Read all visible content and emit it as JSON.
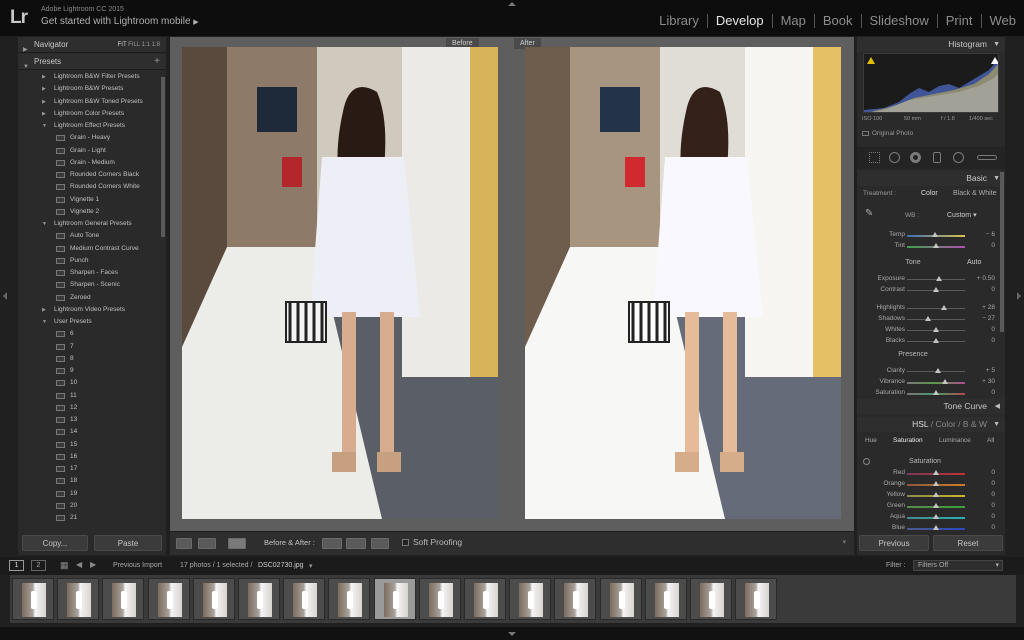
{
  "header": {
    "logo": "Lr",
    "app_version": "Adobe Lightroom CC 2015",
    "get_started": "Get started with Lightroom mobile",
    "get_started_arrow": "▶"
  },
  "modules": [
    "Library",
    "Develop",
    "Map",
    "Book",
    "Slideshow",
    "Print",
    "Web"
  ],
  "navigator": {
    "title": "Navigator",
    "zoom_options": [
      "FIT",
      "FILL",
      "1:1",
      "1:8"
    ]
  },
  "presets": {
    "title": "Presets",
    "add": "+",
    "items": [
      {
        "t": "f",
        "label": "Lightroom B&W Filter Presets",
        "open": false
      },
      {
        "t": "f",
        "label": "Lightroom B&W Presets",
        "open": false
      },
      {
        "t": "f",
        "label": "Lightroom B&W Toned Presets",
        "open": false
      },
      {
        "t": "f",
        "label": "Lightroom Color Presets",
        "open": false
      },
      {
        "t": "f",
        "label": "Lightroom Effect Presets",
        "open": true
      },
      {
        "t": "c",
        "label": "Grain - Heavy"
      },
      {
        "t": "c",
        "label": "Grain - Light"
      },
      {
        "t": "c",
        "label": "Grain - Medium"
      },
      {
        "t": "c",
        "label": "Rounded Corners Black"
      },
      {
        "t": "c",
        "label": "Rounded Corners White"
      },
      {
        "t": "c",
        "label": "Vignette 1"
      },
      {
        "t": "c",
        "label": "Vignette 2"
      },
      {
        "t": "f",
        "label": "Lightroom General Presets",
        "open": true
      },
      {
        "t": "c",
        "label": "Auto Tone"
      },
      {
        "t": "c",
        "label": "Medium Contrast Curve"
      },
      {
        "t": "c",
        "label": "Punch"
      },
      {
        "t": "c",
        "label": "Sharpen - Faces"
      },
      {
        "t": "c",
        "label": "Sharpen - Scenic"
      },
      {
        "t": "c",
        "label": "Zeroed"
      },
      {
        "t": "f",
        "label": "Lightroom Video Presets",
        "open": false
      },
      {
        "t": "f",
        "label": "User Presets",
        "open": true
      },
      {
        "t": "c",
        "label": "6"
      },
      {
        "t": "c",
        "label": "7"
      },
      {
        "t": "c",
        "label": "8"
      },
      {
        "t": "c",
        "label": "9"
      },
      {
        "t": "c",
        "label": "10"
      },
      {
        "t": "c",
        "label": "11"
      },
      {
        "t": "c",
        "label": "12"
      },
      {
        "t": "c",
        "label": "13"
      },
      {
        "t": "c",
        "label": "14"
      },
      {
        "t": "c",
        "label": "15"
      },
      {
        "t": "c",
        "label": "16"
      },
      {
        "t": "c",
        "label": "17"
      },
      {
        "t": "c",
        "label": "18"
      },
      {
        "t": "c",
        "label": "19"
      },
      {
        "t": "c",
        "label": "20"
      },
      {
        "t": "c",
        "label": "21"
      }
    ]
  },
  "left_buttons": {
    "copy": "Copy...",
    "paste": "Paste"
  },
  "view": {
    "before": "Before",
    "after": "After"
  },
  "toolbar": {
    "before_after": "Before & After :",
    "soft_proofing": "Soft Proofing"
  },
  "histogram": {
    "title": "Histogram",
    "iso": "ISO 100",
    "focal": "50 mm",
    "aperture": "f / 1.8",
    "shutter": "1/400 sec",
    "original": "Original Photo"
  },
  "basic": {
    "title": "Basic",
    "treatment_label": "Treatment :",
    "color": "Color",
    "bw": "Black & White",
    "wb_label": "WB :",
    "wb_value": "Custom",
    "tone_label": "Tone",
    "auto": "Auto",
    "presence_label": "Presence",
    "sliders": [
      {
        "k": "temp",
        "label": "Temp",
        "value": "− 6",
        "pos": 0.48,
        "grad": "linear-gradient(90deg,#3d6fb5,#d9c24a)"
      },
      {
        "k": "tint",
        "label": "Tint",
        "value": "0",
        "pos": 0.5,
        "grad": "linear-gradient(90deg,#3fa34a,#b24fb0)"
      },
      {
        "k": "exposure",
        "label": "Exposure",
        "value": "+ 0.50",
        "pos": 0.55
      },
      {
        "k": "contrast",
        "label": "Contrast",
        "value": "0",
        "pos": 0.5
      },
      {
        "k": "highlights",
        "label": "Highlights",
        "value": "+ 28",
        "pos": 0.64
      },
      {
        "k": "shadows",
        "label": "Shadows",
        "value": "− 27",
        "pos": 0.36
      },
      {
        "k": "whites",
        "label": "Whites",
        "value": "0",
        "pos": 0.5
      },
      {
        "k": "blacks",
        "label": "Blacks",
        "value": "0",
        "pos": 0.5
      },
      {
        "k": "clarity",
        "label": "Clarity",
        "value": "+ 5",
        "pos": 0.53
      },
      {
        "k": "vibrance",
        "label": "Vibrance",
        "value": "+ 30",
        "pos": 0.65,
        "grad": "linear-gradient(90deg,#777,#5b9a4b,#b04a8f)"
      },
      {
        "k": "saturation",
        "label": "Saturation",
        "value": "0",
        "pos": 0.5,
        "grad": "linear-gradient(90deg,#777,#4b9a6b,#b04a4a)"
      }
    ]
  },
  "tone_curve": {
    "title": "Tone Curve"
  },
  "hsl": {
    "title": "HSL",
    "color": "Color",
    "bw": "B & W",
    "sep": "/",
    "tabs": [
      "Hue",
      "Saturation",
      "Luminance",
      "All"
    ],
    "section": "Saturation",
    "sliders": [
      {
        "label": "Red",
        "value": "0",
        "grad": "linear-gradient(90deg,#7a3a5a,#c03030)"
      },
      {
        "label": "Orange",
        "value": "0",
        "grad": "linear-gradient(90deg,#8a5a3a,#d07a2a)"
      },
      {
        "label": "Yellow",
        "value": "0",
        "grad": "linear-gradient(90deg,#8a8a4a,#c8b82a)"
      },
      {
        "label": "Green",
        "value": "0",
        "grad": "linear-gradient(90deg,#5a8a4a,#3aa03a)"
      },
      {
        "label": "Aqua",
        "value": "0",
        "grad": "linear-gradient(90deg,#4a8a8a,#2ab0b0)"
      },
      {
        "label": "Blue",
        "value": "0",
        "grad": "linear-gradient(90deg,#4a5a8a,#2a4ac0)"
      }
    ]
  },
  "right_buttons": {
    "previous": "Previous",
    "reset": "Reset"
  },
  "filmstrip": {
    "pages": [
      "1",
      "2"
    ],
    "source": "Previous Import",
    "count": "17 photos / 1 selected /",
    "filename": "DSC02730.jpg",
    "dropdown": "▾",
    "filter_label": "Filter :",
    "filter_value": "Filters Off",
    "thumb_count": 17,
    "selected_index": 8
  },
  "colors": {
    "accent": "#e6e6e6",
    "panel": "#2a2a2a",
    "center_bg": "#5e5e5e"
  }
}
